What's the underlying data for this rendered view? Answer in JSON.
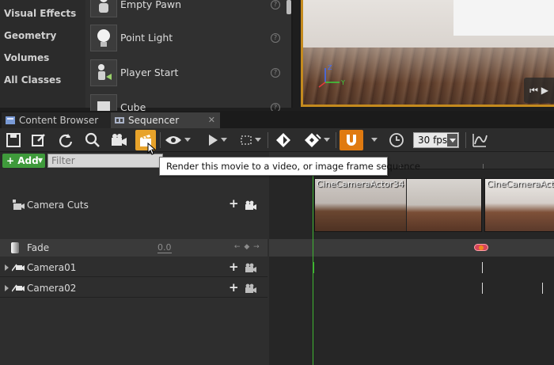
{
  "categories": [
    "Visual Effects",
    "Geometry",
    "Volumes",
    "All Classes"
  ],
  "assets": [
    {
      "label": "Empty Pawn"
    },
    {
      "label": "Point Light"
    },
    {
      "label": "Player Start"
    },
    {
      "label": "Cube"
    }
  ],
  "viewport": {
    "media_icon": "⏮ ▶"
  },
  "tabs": [
    {
      "label": "Content Browser",
      "icon": "content-browser-icon"
    },
    {
      "label": "Sequencer",
      "icon": "sequencer-icon",
      "active": true
    }
  ],
  "toolbar": {
    "fps_value": "30 fps",
    "icons": [
      "save-icon",
      "save-as-icon",
      "refresh-icon",
      "search-icon",
      "camera-icon",
      "render-movie-icon",
      "eye-icon",
      "play-icon",
      "selection-icon",
      "key-icon",
      "keyframe-options-icon",
      "snap-magnet-icon",
      "clock-icon",
      "curve-editor-icon"
    ]
  },
  "filterbar": {
    "add_label": "+ Add",
    "filter_placeholder": "Filter"
  },
  "tooltip": {
    "text": "Render this movie to a video, or image frame sequence"
  },
  "tracks": [
    {
      "label": "Camera Cuts"
    },
    {
      "label": "Fade",
      "value": "0.0"
    },
    {
      "label": "Camera01"
    },
    {
      "label": "Camera02"
    }
  ],
  "timeline": {
    "cuts": [
      {
        "label": "CineCameraActor34"
      },
      {
        "label": "CineCameraActor"
      }
    ]
  },
  "colors": {
    "accent": "#c48a1e",
    "add_green": "#3f9a3b",
    "playhead": "#3fb532",
    "snap": "#e07a10"
  }
}
